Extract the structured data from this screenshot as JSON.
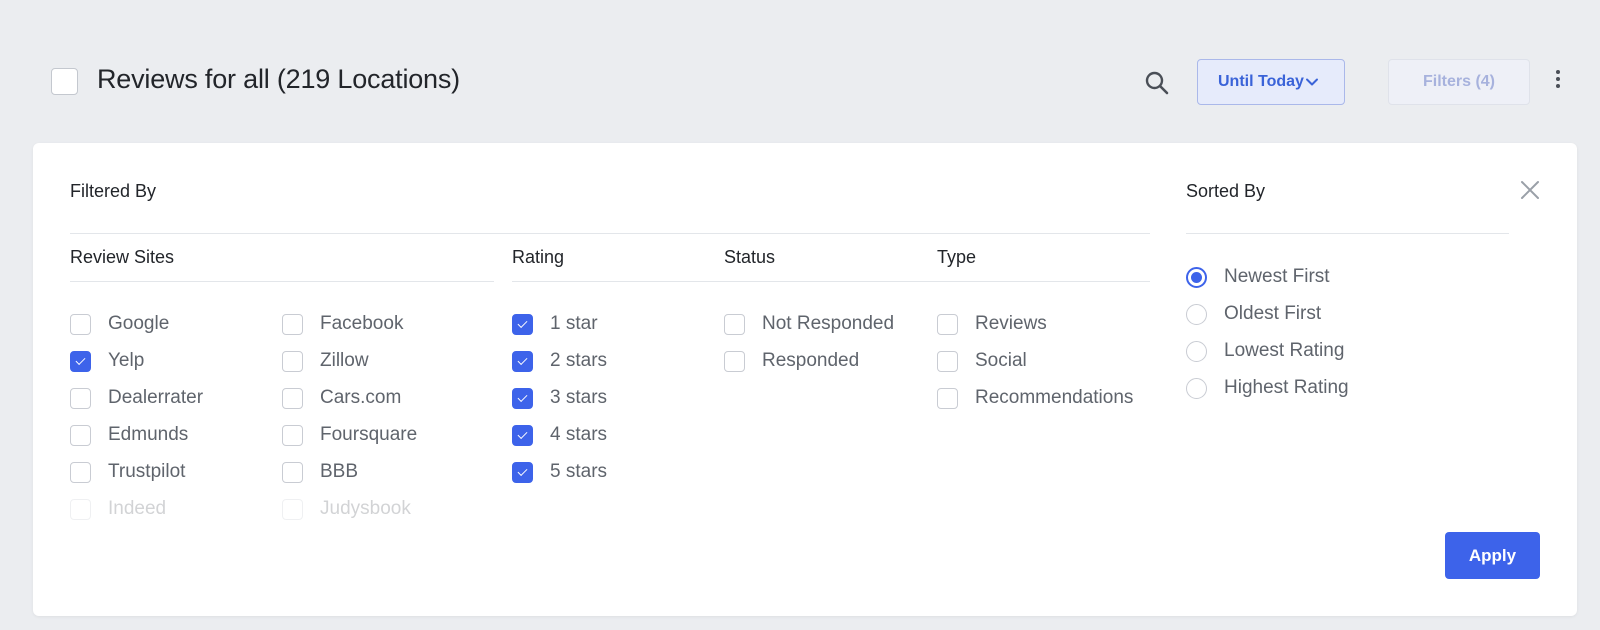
{
  "header": {
    "title": "Reviews for all (219 Locations)",
    "date_range": "Until Today",
    "filters_label": "Filters (4)"
  },
  "panel": {
    "filtered_by": "Filtered By",
    "sorted_by": "Sorted By",
    "review_sites": {
      "heading": "Review Sites",
      "col1": [
        {
          "label": "Google",
          "checked": false
        },
        {
          "label": "Yelp",
          "checked": true
        },
        {
          "label": "Dealerrater",
          "checked": false
        },
        {
          "label": "Edmunds",
          "checked": false
        },
        {
          "label": "Trustpilot",
          "checked": false
        },
        {
          "label": "Indeed",
          "checked": false
        }
      ],
      "col2": [
        {
          "label": "Facebook",
          "checked": false
        },
        {
          "label": "Zillow",
          "checked": false
        },
        {
          "label": "Cars.com",
          "checked": false
        },
        {
          "label": "Foursquare",
          "checked": false
        },
        {
          "label": "BBB",
          "checked": false
        },
        {
          "label": "Judysbook",
          "checked": false
        }
      ]
    },
    "rating": {
      "heading": "Rating",
      "options": [
        {
          "label": "1 star",
          "checked": true
        },
        {
          "label": "2 stars",
          "checked": true
        },
        {
          "label": "3 stars",
          "checked": true
        },
        {
          "label": "4 stars",
          "checked": true
        },
        {
          "label": "5 stars",
          "checked": true
        }
      ]
    },
    "status": {
      "heading": "Status",
      "options": [
        {
          "label": "Not Responded",
          "checked": false
        },
        {
          "label": "Responded",
          "checked": false
        }
      ]
    },
    "type": {
      "heading": "Type",
      "options": [
        {
          "label": "Reviews",
          "checked": false
        },
        {
          "label": "Social",
          "checked": false
        },
        {
          "label": "Recommendations",
          "checked": false
        }
      ]
    },
    "sort": {
      "options": [
        {
          "label": "Newest First",
          "selected": true
        },
        {
          "label": "Oldest First",
          "selected": false
        },
        {
          "label": "Lowest Rating",
          "selected": false
        },
        {
          "label": "Highest Rating",
          "selected": false
        }
      ]
    },
    "apply_label": "Apply"
  },
  "colors": {
    "accent": "#3d63ea",
    "background": "#ebedf0",
    "panel": "#ffffff"
  },
  "icons": {
    "search": "search-icon",
    "dropdown": "chevron-down-icon",
    "more": "kebab-menu-icon",
    "close": "close-icon"
  }
}
